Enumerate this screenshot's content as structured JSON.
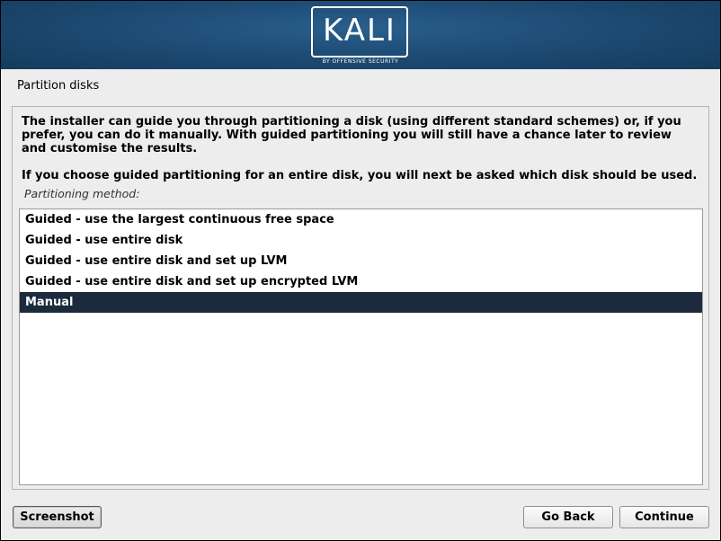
{
  "banner": {
    "logo_text": "KALI",
    "logo_subtitle": "BY OFFENSIVE SECURITY"
  },
  "page": {
    "title": "Partition disks"
  },
  "content": {
    "description": "The installer can guide you through partitioning a disk (using different standard schemes) or, if you prefer, you can do it manually. With guided partitioning you will still have a chance later to review and customise the results.",
    "description2": "If you choose guided partitioning for an entire disk, you will next be asked which disk should be used.",
    "method_label": "Partitioning method:",
    "options": [
      {
        "label": "Guided - use the largest continuous free space",
        "selected": false
      },
      {
        "label": "Guided - use entire disk",
        "selected": false
      },
      {
        "label": "Guided - use entire disk and set up LVM",
        "selected": false
      },
      {
        "label": "Guided - use entire disk and set up encrypted LVM",
        "selected": false
      },
      {
        "label": "Manual",
        "selected": true
      }
    ]
  },
  "buttons": {
    "screenshot": "Screenshot",
    "go_back": "Go Back",
    "continue": "Continue"
  },
  "colors": {
    "banner": "#1f4e78",
    "selection": "#1c2a3d",
    "background": "#ededed"
  }
}
